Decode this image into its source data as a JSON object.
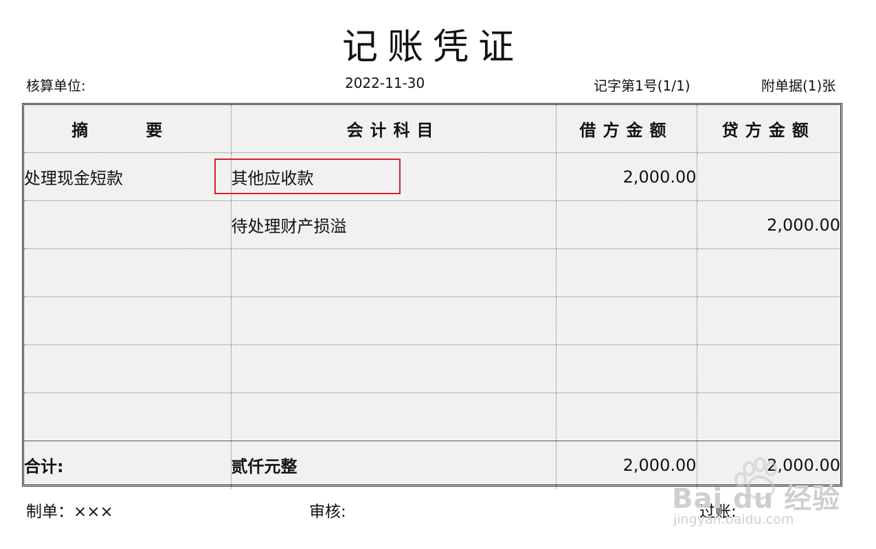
{
  "voucher": {
    "title": "记账凭证",
    "unit_label": "核算单位:",
    "date": "2022-11-30",
    "voucher_no": "记字第1号(1/1)",
    "attachments": "附单据(1)张"
  },
  "table": {
    "headers": [
      "摘　要",
      "会计科目",
      "借方金额",
      "贷方金额"
    ],
    "rows": [
      {
        "summary": "处理现金短款",
        "account": "其他应收款",
        "debit": "2,000.00",
        "credit": ""
      },
      {
        "summary": "",
        "account": "待处理财产损溢",
        "debit": "",
        "credit": "2,000.00"
      },
      {
        "summary": "",
        "account": "",
        "debit": "",
        "credit": ""
      },
      {
        "summary": "",
        "account": "",
        "debit": "",
        "credit": ""
      },
      {
        "summary": "",
        "account": "",
        "debit": "",
        "credit": ""
      },
      {
        "summary": "",
        "account": "",
        "debit": "",
        "credit": ""
      }
    ],
    "total": {
      "label": "合计:",
      "amount_words": "贰仟元整",
      "debit": "2,000.00",
      "credit": "2,000.00"
    }
  },
  "footer": {
    "maker": "制单：×××",
    "reviewer": "审核:",
    "posting": "过账:"
  },
  "watermark": {
    "brand": "Bai du 经验",
    "url": "jingyan.baidu.com"
  },
  "colors": {
    "highlight": "#d0232b",
    "table_bg": "#f1f1f1"
  }
}
